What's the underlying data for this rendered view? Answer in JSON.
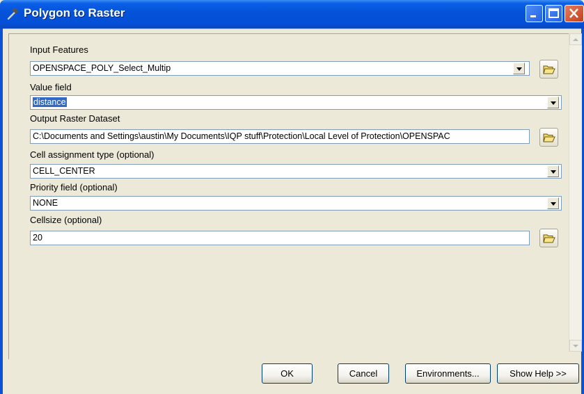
{
  "window": {
    "title": "Polygon to Raster"
  },
  "fields": {
    "input_features": {
      "label": "Input Features",
      "value": "OPENSPACE_POLY_Select_Multip"
    },
    "value_field": {
      "label": "Value field",
      "value": "distance"
    },
    "output_raster": {
      "label": "Output Raster Dataset",
      "value": "C:\\Documents and Settings\\austin\\My Documents\\IQP stuff\\Protection\\Local Level of Protection\\OPENSPAC"
    },
    "cell_assignment": {
      "label": "Cell assignment type (optional)",
      "value": "CELL_CENTER"
    },
    "priority_field": {
      "label": "Priority field (optional)",
      "value": "NONE"
    },
    "cellsize": {
      "label": "Cellsize (optional)",
      "value": "20"
    }
  },
  "buttons": {
    "ok": "OK",
    "cancel": "Cancel",
    "environments": "Environments...",
    "show_help": "Show Help >>"
  },
  "icons": {
    "title": "hammer-icon",
    "browse": "open-folder-icon"
  },
  "colors": {
    "titlebar": "#0552d8",
    "selection": "#316ac5",
    "close_button": "#c33f1a"
  }
}
